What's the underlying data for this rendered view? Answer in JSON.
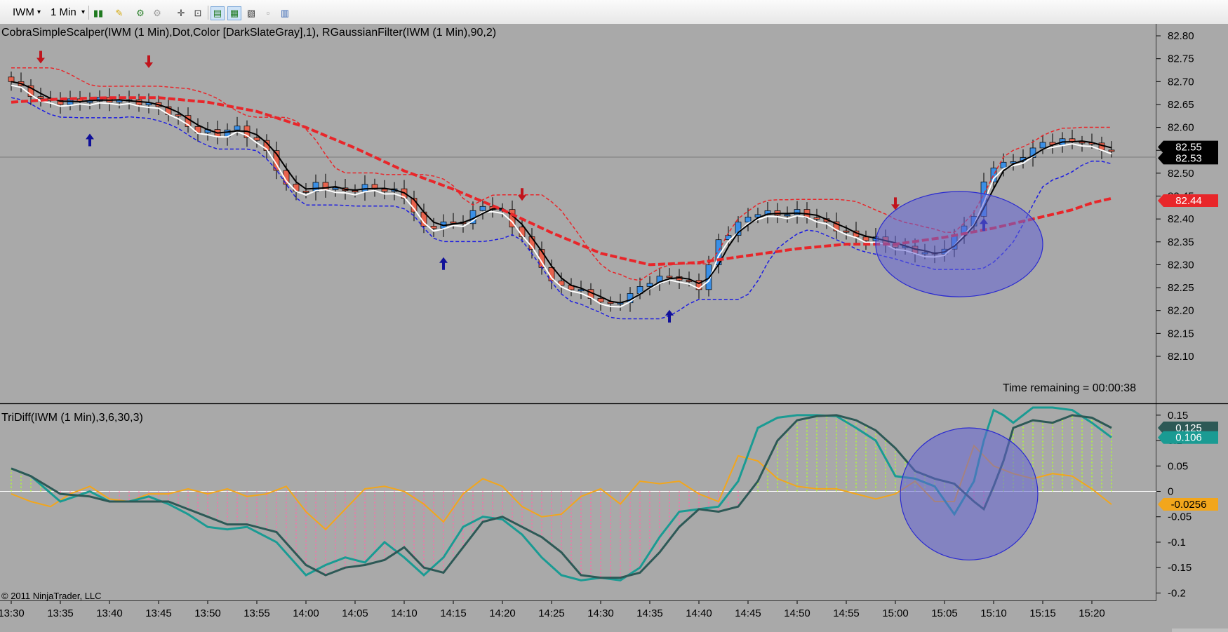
{
  "toolbar": {
    "instrument": "IWM",
    "interval": "1 Min",
    "icons": [
      "bar-style-icon",
      "draw-tool-icon",
      "chart-tool-icon",
      "crosshair-icon",
      "zoom-icon",
      "data-box-icon",
      "properties-icon",
      "chart-trader-icon",
      "indicator-icon",
      "strategy-icon"
    ]
  },
  "price_panel": {
    "title": "CobraSimpleScalper(IWM (1 Min),Dot,Color [DarkSlateGray],1),   RGaussianFilter(IWM (1 Min),90,2)",
    "time_remaining": "Time remaining = 00:00:38",
    "price_labels": [
      {
        "text": "82.55",
        "bg": "#000000",
        "fg": "#ffffff",
        "value": 82.557
      },
      {
        "text": "82.53",
        "bg": "#000000",
        "fg": "#ffffff",
        "value": 82.533
      },
      {
        "text": "82.44",
        "bg": "#e8262a",
        "fg": "#ffffff",
        "value": 82.44
      }
    ]
  },
  "indicator_panel": {
    "title": "TriDiff(IWM (1 Min),3,6,30,3)",
    "copyright": "© 2011 NinjaTrader, LLC",
    "value_labels": [
      {
        "text": "0.125",
        "bg": "#2d5956",
        "fg": "#ffffff",
        "value": 0.125
      },
      {
        "text": "0.106",
        "bg": "#1a9b93",
        "fg": "#ffffff",
        "value": 0.106
      },
      {
        "text": "-0.0256",
        "bg": "#f2a61c",
        "fg": "#000000",
        "value": -0.0256
      }
    ]
  },
  "colors": {
    "background": "#a9a9a9",
    "up_candle": "#3a8fe6",
    "down_candle": "#e8634d",
    "gaussian": "#e8262a",
    "scalper": "#000000",
    "white_line": "#ffffff",
    "band_upper": "#e8262a",
    "band_lower": "#1d1de0",
    "arrow_down": "#c0141c",
    "arrow_up": "#101099",
    "ellipse_fill": "#6464d6",
    "tri_dark": "#2d5956",
    "tri_teal": "#1a9b93",
    "tri_orange": "#f2a61c",
    "hist_pos": "#b0ff30",
    "hist_neg": "#ff6aa8"
  },
  "chart_data": [
    {
      "type": "candlestick",
      "title": "CobraSimpleScalper(IWM (1 Min),Dot,Color [DarkSlateGray],1),   RGaussianFilter(IWM (1 Min),90,2)",
      "y_ticks": [
        "82.80",
        "82.75",
        "82.70",
        "82.65",
        "82.60",
        "82.55",
        "82.50",
        "82.45",
        "82.40",
        "82.35",
        "82.30",
        "82.25",
        "82.20",
        "82.15",
        "82.10"
      ],
      "ylim": [
        82.1,
        82.82
      ],
      "x_ticks": [
        "13:30",
        "13:35",
        "13:40",
        "13:45",
        "13:50",
        "13:55",
        "14:00",
        "14:05",
        "14:10",
        "14:15",
        "14:20",
        "14:25",
        "14:30",
        "14:35",
        "14:40",
        "14:45",
        "14:50",
        "14:55",
        "15:00",
        "15:05",
        "15:10",
        "15:15",
        "15:20"
      ],
      "x_start_minute": 0,
      "x_end_minute": 112,
      "series": [
        {
          "name": "RGaussianFilter",
          "x": [
            0,
            5,
            10,
            15,
            20,
            25,
            30,
            35,
            40,
            45,
            50,
            55,
            60,
            65,
            70,
            75,
            80,
            85,
            90,
            95,
            100,
            105,
            108,
            110,
            112
          ],
          "y": [
            82.655,
            82.662,
            82.665,
            82.665,
            82.655,
            82.635,
            82.6,
            82.555,
            82.505,
            82.465,
            82.42,
            82.37,
            82.325,
            82.3,
            82.305,
            82.32,
            82.335,
            82.345,
            82.345,
            82.36,
            82.38,
            82.405,
            82.42,
            82.435,
            82.445
          ]
        }
      ],
      "signals": {
        "down_arrows": [
          3,
          14,
          52,
          90
        ],
        "up_arrows": [
          8,
          44,
          67,
          99
        ]
      },
      "highlight": {
        "center_minute": 96.5,
        "center_value": 82.345,
        "radius_minutes": 8.5,
        "radius_value": 0.115
      }
    },
    {
      "type": "line",
      "title": "TriDiff(IWM (1 Min),3,6,30,3)",
      "y_ticks": [
        "0.15",
        "0.1",
        "0.05",
        "0",
        "-0.05",
        "-0.1",
        "-0.15",
        "-0.2"
      ],
      "ylim": [
        -0.205,
        0.165
      ],
      "x_start_minute": 0,
      "x_end_minute": 112,
      "series": [
        {
          "name": "Dark",
          "x": [
            0,
            2,
            5,
            8,
            10,
            12,
            14,
            16,
            18,
            20,
            22,
            24,
            27,
            30,
            32,
            34,
            36,
            38,
            40,
            42,
            44,
            46,
            48,
            50,
            52,
            54,
            56,
            58,
            60,
            62,
            64,
            66,
            68,
            70,
            72,
            74,
            76,
            78,
            80,
            82,
            84,
            86,
            88,
            90,
            92,
            94,
            96,
            98,
            99,
            100,
            101,
            102,
            104,
            106,
            108,
            110,
            112
          ],
          "y": [
            0.045,
            0.03,
            -0.005,
            -0.01,
            -0.02,
            -0.02,
            -0.02,
            -0.02,
            -0.035,
            -0.05,
            -0.065,
            -0.065,
            -0.08,
            -0.145,
            -0.165,
            -0.15,
            -0.145,
            -0.135,
            -0.11,
            -0.15,
            -0.16,
            -0.11,
            -0.06,
            -0.05,
            -0.07,
            -0.09,
            -0.12,
            -0.165,
            -0.17,
            -0.17,
            -0.16,
            -0.12,
            -0.07,
            -0.035,
            -0.04,
            -0.03,
            0.02,
            0.1,
            0.14,
            0.148,
            0.15,
            0.14,
            0.12,
            0.085,
            0.04,
            0.025,
            0.015,
            -0.02,
            -0.035,
            0.01,
            0.06,
            0.125,
            0.14,
            0.135,
            0.15,
            0.145,
            0.125
          ]
        },
        {
          "name": "Teal",
          "x": [
            0,
            2,
            5,
            8,
            10,
            12,
            14,
            16,
            18,
            20,
            22,
            24,
            27,
            30,
            32,
            34,
            36,
            38,
            40,
            42,
            44,
            46,
            48,
            50,
            52,
            54,
            56,
            58,
            60,
            62,
            64,
            66,
            68,
            70,
            72,
            74,
            76,
            78,
            80,
            82,
            84,
            86,
            88,
            90,
            92,
            94,
            96,
            98,
            99,
            100,
            101,
            102,
            104,
            106,
            108,
            110,
            112
          ],
          "y": [
            0.045,
            0.03,
            -0.02,
            0.0,
            -0.02,
            -0.02,
            -0.01,
            -0.025,
            -0.045,
            -0.07,
            -0.075,
            -0.07,
            -0.1,
            -0.165,
            -0.145,
            -0.13,
            -0.14,
            -0.1,
            -0.13,
            -0.165,
            -0.13,
            -0.07,
            -0.05,
            -0.055,
            -0.085,
            -0.13,
            -0.165,
            -0.175,
            -0.17,
            -0.175,
            -0.15,
            -0.09,
            -0.04,
            -0.035,
            -0.03,
            0.02,
            0.125,
            0.145,
            0.15,
            0.15,
            0.148,
            0.125,
            0.1,
            0.03,
            0.025,
            0.01,
            -0.045,
            0.02,
            0.1,
            0.16,
            0.15,
            0.135,
            0.165,
            0.165,
            0.16,
            0.135,
            0.106
          ]
        },
        {
          "name": "Orange",
          "x": [
            0,
            2,
            4,
            6,
            8,
            10,
            12,
            14,
            16,
            18,
            20,
            22,
            24,
            26,
            28,
            30,
            32,
            34,
            36,
            38,
            40,
            42,
            44,
            46,
            48,
            50,
            52,
            54,
            56,
            58,
            60,
            62,
            64,
            66,
            68,
            70,
            72,
            74,
            76,
            78,
            80,
            82,
            84,
            86,
            88,
            90,
            92,
            94,
            96,
            98,
            100,
            102,
            104,
            106,
            108,
            110,
            112
          ],
          "y": [
            -0.005,
            -0.02,
            -0.03,
            -0.005,
            0.01,
            -0.015,
            -0.02,
            -0.005,
            -0.005,
            0.005,
            -0.005,
            0.005,
            -0.01,
            -0.005,
            0.01,
            -0.04,
            -0.075,
            -0.035,
            0.005,
            0.01,
            0.0,
            -0.025,
            -0.06,
            -0.005,
            0.025,
            0.01,
            -0.03,
            -0.05,
            -0.045,
            -0.01,
            0.005,
            -0.025,
            0.02,
            0.015,
            0.02,
            -0.005,
            -0.02,
            0.07,
            0.06,
            0.025,
            0.01,
            0.005,
            0.005,
            -0.005,
            -0.015,
            -0.005,
            0.02,
            -0.02,
            -0.02,
            0.09,
            0.05,
            0.035,
            0.025,
            0.035,
            0.03,
            0.005,
            -0.0256
          ]
        }
      ],
      "highlight": {
        "center_minute": 97.5,
        "center_value": -0.005,
        "radius_minutes": 7,
        "radius_value": 0.13
      }
    }
  ]
}
